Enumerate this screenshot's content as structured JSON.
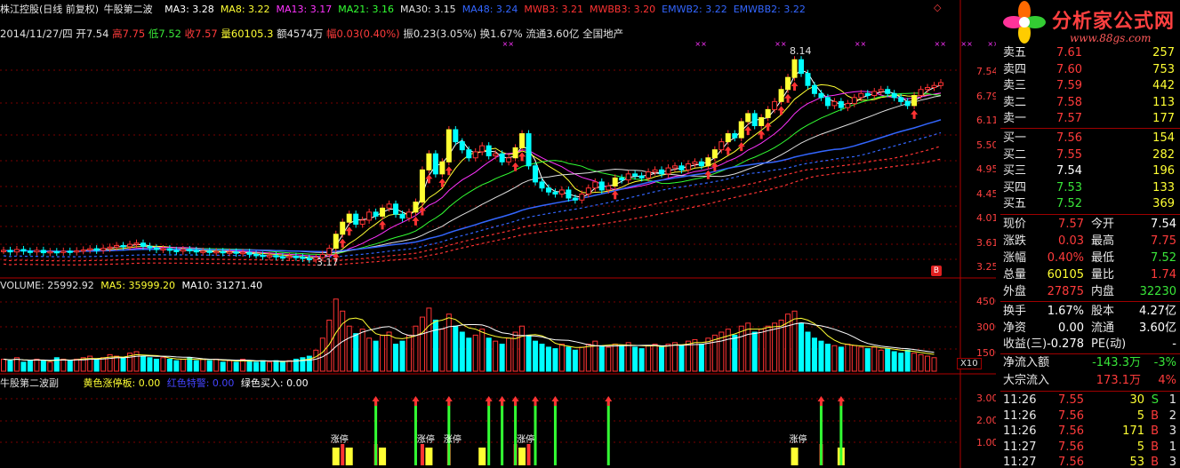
{
  "header": {
    "stock": "株江控股(日线 前复权)",
    "formula": "牛股第二波",
    "ma": [
      {
        "name": "MA3:",
        "value": "3.28",
        "color": "#ffffff"
      },
      {
        "name": "MA8:",
        "value": "3.22",
        "color": "#ffff33"
      },
      {
        "name": "MA13:",
        "value": "3.17",
        "color": "#ff33ff"
      },
      {
        "name": "MA21:",
        "value": "3.16",
        "color": "#33ff33"
      },
      {
        "name": "MA30:",
        "value": "3.15",
        "color": "#e0e0e0"
      },
      {
        "name": "MA48:",
        "value": "3.24",
        "color": "#3366ff"
      },
      {
        "name": "MWB3:",
        "value": "3.21",
        "color": "#ff3333"
      },
      {
        "name": "MWBB3:",
        "value": "3.20",
        "color": "#ff3333"
      },
      {
        "name": "EMWB2:",
        "value": "3.22",
        "color": "#3366ff"
      },
      {
        "name": "EMWBB2:",
        "value": "3.22",
        "color": "#3366ff"
      }
    ],
    "info_date": "2014/11/27/四",
    "open_l": "开",
    "open": "7.54",
    "high_l": "高",
    "high": "7.75",
    "low_l": "低",
    "low": "7.52",
    "close_l": "收",
    "close": "7.57",
    "vol_l": "量",
    "vol": "60105.3",
    "amt_l": "额",
    "amt": "4574万",
    "chg_l": "幅",
    "chg": "0.03(0.40%)",
    "amp": "振0.23(3.05%)",
    "turn": "换1.67%",
    "flow": "流通3.60亿",
    "sector": "全国地产"
  },
  "price_axis": [
    "7.54",
    "6.79",
    "6.11",
    "5.50",
    "4.95",
    "4.45",
    "4.01",
    "3.61",
    "3.25"
  ],
  "price_marks": {
    "high": "8.14",
    "low": "3.17",
    "b_badge": "B"
  },
  "volume": {
    "title": "VOLUME: 25992.92",
    "ma5": "MA5: 35999.20",
    "ma10": "MA10: 31271.40",
    "axis": [
      "45000",
      "30000",
      "15000"
    ],
    "unit": "X10"
  },
  "indicator": {
    "title": "牛股第二波副",
    "yellow": "黄色涨停板: 0.00",
    "red": "红色特警: 0.00",
    "green": "绿色买入: 0.00",
    "axis": [
      "3.00",
      "2.00",
      "1.00"
    ],
    "up_label": "涨停"
  },
  "logo": {
    "title": "分析家公式网",
    "url": "www.88gs.com"
  },
  "orderbook": [
    {
      "label": "卖五",
      "price": "7.61",
      "vol": "257",
      "pc": "red"
    },
    {
      "label": "卖四",
      "price": "7.60",
      "vol": "753",
      "pc": "red"
    },
    {
      "label": "卖三",
      "price": "7.59",
      "vol": "442",
      "pc": "red"
    },
    {
      "label": "卖二",
      "price": "7.58",
      "vol": "113",
      "pc": "red"
    },
    {
      "label": "卖一",
      "price": "7.57",
      "vol": "177",
      "pc": "red"
    },
    {
      "label": "买一",
      "price": "7.56",
      "vol": "154",
      "pc": "red"
    },
    {
      "label": "买二",
      "price": "7.55",
      "vol": "282",
      "pc": "red"
    },
    {
      "label": "买三",
      "price": "7.54",
      "vol": "196",
      "pc": "white"
    },
    {
      "label": "买四",
      "price": "7.53",
      "vol": "133",
      "pc": "green"
    },
    {
      "label": "买五",
      "price": "7.52",
      "vol": "369",
      "pc": "green"
    }
  ],
  "stats": [
    {
      "l1": "现价",
      "v1": "7.57",
      "c1": "red",
      "l2": "今开",
      "v2": "7.54",
      "c2": "white"
    },
    {
      "l1": "涨跌",
      "v1": "0.03",
      "c1": "red",
      "l2": "最高",
      "v2": "7.75",
      "c2": "red"
    },
    {
      "l1": "涨幅",
      "v1": "0.40%",
      "c1": "red",
      "l2": "最低",
      "v2": "7.52",
      "c2": "green"
    },
    {
      "l1": "总量",
      "v1": "60105",
      "c1": "yellow",
      "l2": "量比",
      "v2": "1.74",
      "c2": "red"
    },
    {
      "l1": "外盘",
      "v1": "27875",
      "c1": "red",
      "l2": "内盘",
      "v2": "32230",
      "c2": "green"
    }
  ],
  "stats2": [
    {
      "l1": "换手",
      "v1": "1.67%",
      "c1": "white",
      "l2": "股本",
      "v2": "4.27亿",
      "c2": "white"
    },
    {
      "l1": "净资",
      "v1": "0.00",
      "c1": "white",
      "l2": "流通",
      "v2": "3.60亿",
      "c2": "white"
    },
    {
      "l1": "收益(三)",
      "v1": "-0.278",
      "c1": "white",
      "l2": "PE(动)",
      "v2": "-",
      "c2": "white"
    }
  ],
  "flows": [
    {
      "label": "净流入额",
      "value": "-143.3万",
      "vc": "green",
      "pct": "-3%",
      "pcc": "green"
    },
    {
      "label": "大宗流入",
      "value": "173.1万",
      "vc": "red",
      "pct": "4%",
      "pcc": "red"
    }
  ],
  "ticks": [
    {
      "time": "11:26",
      "price": "7.55",
      "vol": "30",
      "side": "S",
      "sc": "green",
      "n": "1"
    },
    {
      "time": "11:26",
      "price": "7.56",
      "vol": "5",
      "side": "B",
      "sc": "red",
      "n": "2"
    },
    {
      "time": "11:26",
      "price": "7.56",
      "vol": "171",
      "side": "B",
      "sc": "red",
      "n": "3"
    },
    {
      "time": "11:27",
      "price": "7.56",
      "vol": "5",
      "side": "B",
      "sc": "red",
      "n": "1"
    },
    {
      "time": "11:27",
      "price": "7.56",
      "vol": "53",
      "side": "B",
      "sc": "red",
      "n": "3"
    }
  ],
  "chart_data": {
    "type": "candlestick",
    "ylim": [
      3.0,
      8.3
    ],
    "volume_ylim": [
      0,
      52000
    ],
    "indicator_ylim": [
      0,
      3.5
    ],
    "candles": [
      3.4,
      3.36,
      3.42,
      3.38,
      3.36,
      3.4,
      3.34,
      3.37,
      3.35,
      3.38,
      3.36,
      3.39,
      3.41,
      3.44,
      3.4,
      3.45,
      3.48,
      3.52,
      3.49,
      3.55,
      3.58,
      3.5,
      3.46,
      3.42,
      3.44,
      3.4,
      3.38,
      3.42,
      3.4,
      3.36,
      3.38,
      3.35,
      3.37,
      3.34,
      3.36,
      3.33,
      3.35,
      3.3,
      3.28,
      3.25,
      3.27,
      3.24,
      3.22,
      3.25,
      3.23,
      3.2,
      3.17,
      3.22,
      3.3,
      3.45,
      3.8,
      4.1,
      4.3,
      4.05,
      4.15,
      4.35,
      4.25,
      4.45,
      4.55,
      4.3,
      4.2,
      4.35,
      4.6,
      5.4,
      5.8,
      5.3,
      5.6,
      6.4,
      6.1,
      5.9,
      5.7,
      5.85,
      6.0,
      5.75,
      5.8,
      5.6,
      5.7,
      5.95,
      6.3,
      5.5,
      5.1,
      4.95,
      4.85,
      4.8,
      4.9,
      4.7,
      4.65,
      4.8,
      4.95,
      5.1,
      4.9,
      5.0,
      5.2,
      5.15,
      5.3,
      5.25,
      5.2,
      5.35,
      5.4,
      5.3,
      5.45,
      5.5,
      5.4,
      5.55,
      5.6,
      5.5,
      5.7,
      5.9,
      6.1,
      6.3,
      6.2,
      6.6,
      6.8,
      6.5,
      6.7,
      6.9,
      7.1,
      7.4,
      7.7,
      8.14,
      7.8,
      7.5,
      7.3,
      7.2,
      7.0,
      7.1,
      6.95,
      7.05,
      7.2,
      7.3,
      7.25,
      7.35,
      7.4,
      7.3,
      7.2,
      7.1,
      7.0,
      7.25,
      7.4,
      7.45,
      7.5,
      7.57
    ],
    "volumes": [
      8,
      7,
      9,
      6,
      7,
      8,
      7,
      6,
      9,
      8,
      7,
      8,
      9,
      10,
      8,
      9,
      11,
      10,
      9,
      12,
      13,
      10,
      9,
      8,
      9,
      8,
      7,
      8,
      9,
      7,
      8,
      7,
      8,
      6,
      7,
      6,
      8,
      7,
      6,
      7,
      6,
      7,
      6,
      7,
      8,
      9,
      10,
      14,
      22,
      34,
      48,
      40,
      30,
      25,
      28,
      22,
      20,
      24,
      26,
      18,
      20,
      24,
      30,
      36,
      42,
      34,
      28,
      38,
      30,
      26,
      22,
      24,
      28,
      22,
      20,
      18,
      22,
      26,
      30,
      24,
      20,
      18,
      16,
      15,
      18,
      16,
      14,
      16,
      18,
      20,
      17,
      16,
      18,
      17,
      19,
      16,
      15,
      17,
      18,
      16,
      18,
      19,
      17,
      20,
      21,
      18,
      22,
      24,
      26,
      28,
      24,
      30,
      32,
      26,
      28,
      30,
      32,
      34,
      38,
      40,
      32,
      26,
      22,
      20,
      18,
      17,
      16,
      18,
      17,
      16,
      15,
      16,
      14,
      15,
      13,
      12,
      14,
      12,
      11,
      10,
      9
    ]
  }
}
